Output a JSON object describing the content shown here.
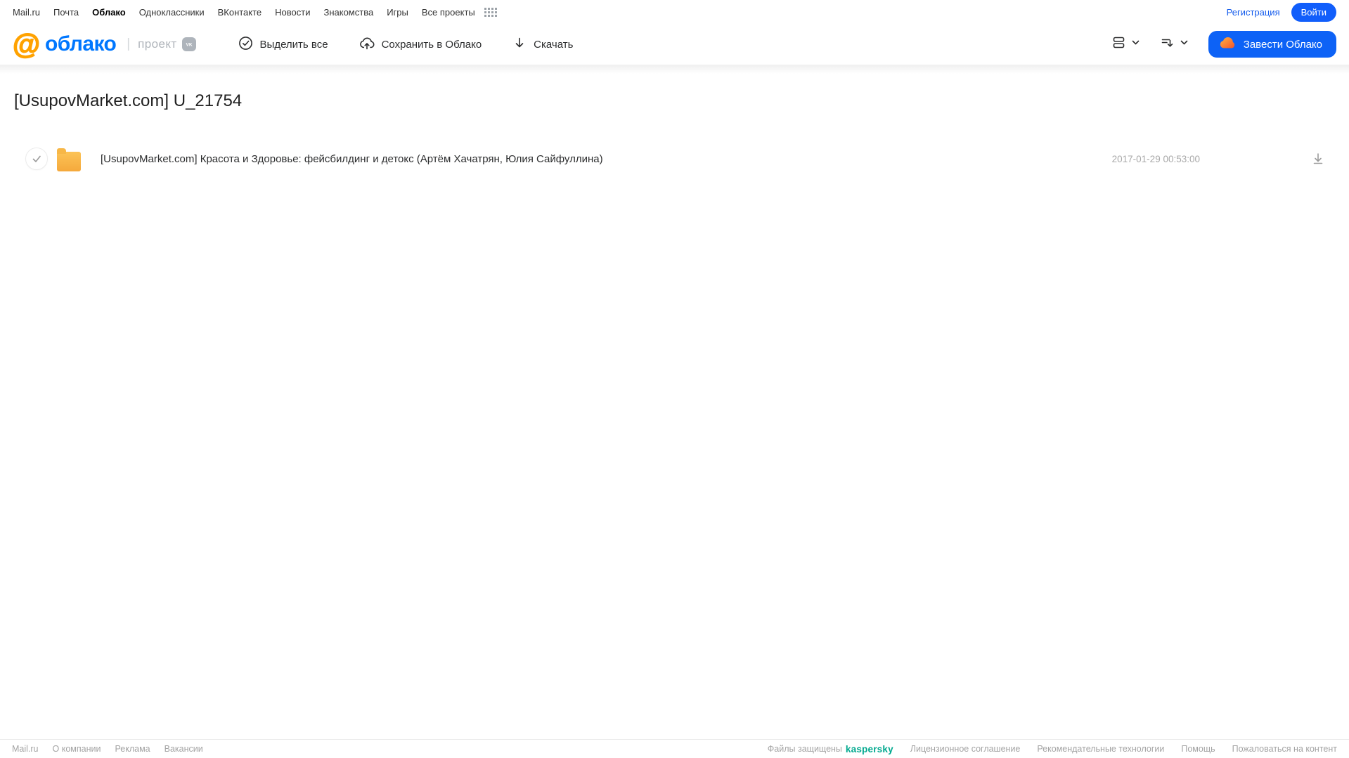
{
  "topnav": {
    "links": [
      "Mail.ru",
      "Почта",
      "Облако",
      "Одноклассники",
      "ВКонтакте",
      "Новости",
      "Знакомства",
      "Игры",
      "Все проекты"
    ],
    "active_link": "Облако",
    "registration_label": "Регистрация",
    "login_label": "Войти"
  },
  "header": {
    "logo": {
      "at_symbol": "@",
      "brand": "облако",
      "project_label": "проект",
      "vk_badge": "VK"
    },
    "toolbar": [
      {
        "label": "Выделить все"
      },
      {
        "label": "Сохранить в Облако"
      },
      {
        "label": "Скачать"
      }
    ],
    "create_cloud_label": "Завести Облако"
  },
  "main": {
    "title": "[UsupovMarket.com] U_21754",
    "files": [
      {
        "name": "[UsupovMarket.com] Красота и Здоровье:  фейсбилдинг и детокс (Артём Хачатрян, Юлия Сайфуллина)",
        "date": "2017-01-29 00:53:00"
      }
    ]
  },
  "footer": {
    "left_links": [
      "Mail.ru",
      "О компании",
      "Реклама",
      "Вакансии"
    ],
    "protected_prefix": "Файлы защищены",
    "kaspersky_logo": "kaspersky",
    "right_links": [
      "Лицензионное соглашение",
      "Рекомендательные технологии",
      "Помощь",
      "Пожаловаться на контент"
    ]
  },
  "colors": {
    "accent_blue": "#0d62f6",
    "brand_blue": "#0077ff",
    "brand_orange": "#ffa201",
    "folder_yellow": "#f7b747",
    "kaspersky_green": "#00a88e"
  }
}
